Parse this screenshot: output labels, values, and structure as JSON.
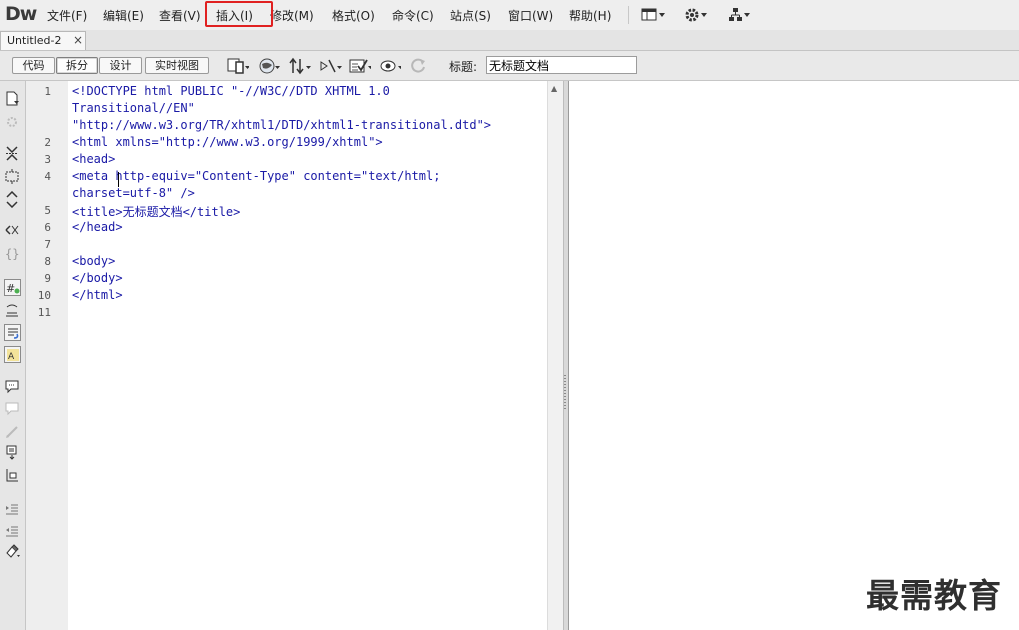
{
  "app": {
    "logo": "Dw"
  },
  "menu": {
    "items": [
      {
        "label": "文件(F)"
      },
      {
        "label": "编辑(E)"
      },
      {
        "label": "查看(V)"
      },
      {
        "label": "插入(I)"
      },
      {
        "label": "修改(M)"
      },
      {
        "label": "格式(O)"
      },
      {
        "label": "命令(C)"
      },
      {
        "label": "站点(S)"
      },
      {
        "label": "窗口(W)"
      },
      {
        "label": "帮助(H)"
      }
    ],
    "highlighted": "插入(I)",
    "highlight_color": "#e02020",
    "tool_icons": [
      "layout-icon",
      "gear-icon",
      "site-structure-icon"
    ]
  },
  "tab": {
    "label": "Untitled-2",
    "close": "×"
  },
  "toolbar": {
    "views": [
      {
        "label": "代码"
      },
      {
        "label": "拆分"
      },
      {
        "label": "设计"
      },
      {
        "label": "实时视图"
      }
    ],
    "active_view": "拆分",
    "icons": [
      "multiscreen-icon",
      "preview-browser-icon",
      "file-management-icon",
      "live-code-icon",
      "check-page-icon",
      "visual-aids-icon",
      "refresh-icon"
    ],
    "title_label": "标题:",
    "title_value": "无标题文档"
  },
  "editor": {
    "line_numbers": [
      "1",
      "2",
      "3",
      "4",
      "5",
      "6",
      "7",
      "8",
      "9",
      "10",
      "11"
    ],
    "lines": [
      "<!DOCTYPE html PUBLIC \"-//W3C//DTD XHTML 1.0",
      "Transitional//EN\"",
      "\"http://www.w3.org/TR/xhtml1/DTD/xhtml1-transitional.dtd\">",
      "<html xmlns=\"http://www.w3.org/1999/xhtml\">",
      "<head>",
      "<meta http-equiv=\"Content-Type\" content=\"text/html;",
      "charset=utf-8\" />",
      "<title>无标题文档</title>",
      "</head>",
      "",
      "<body>",
      "</body>",
      "</html>"
    ],
    "code_color": "#1a1aa6"
  },
  "watermark": "最需教育"
}
